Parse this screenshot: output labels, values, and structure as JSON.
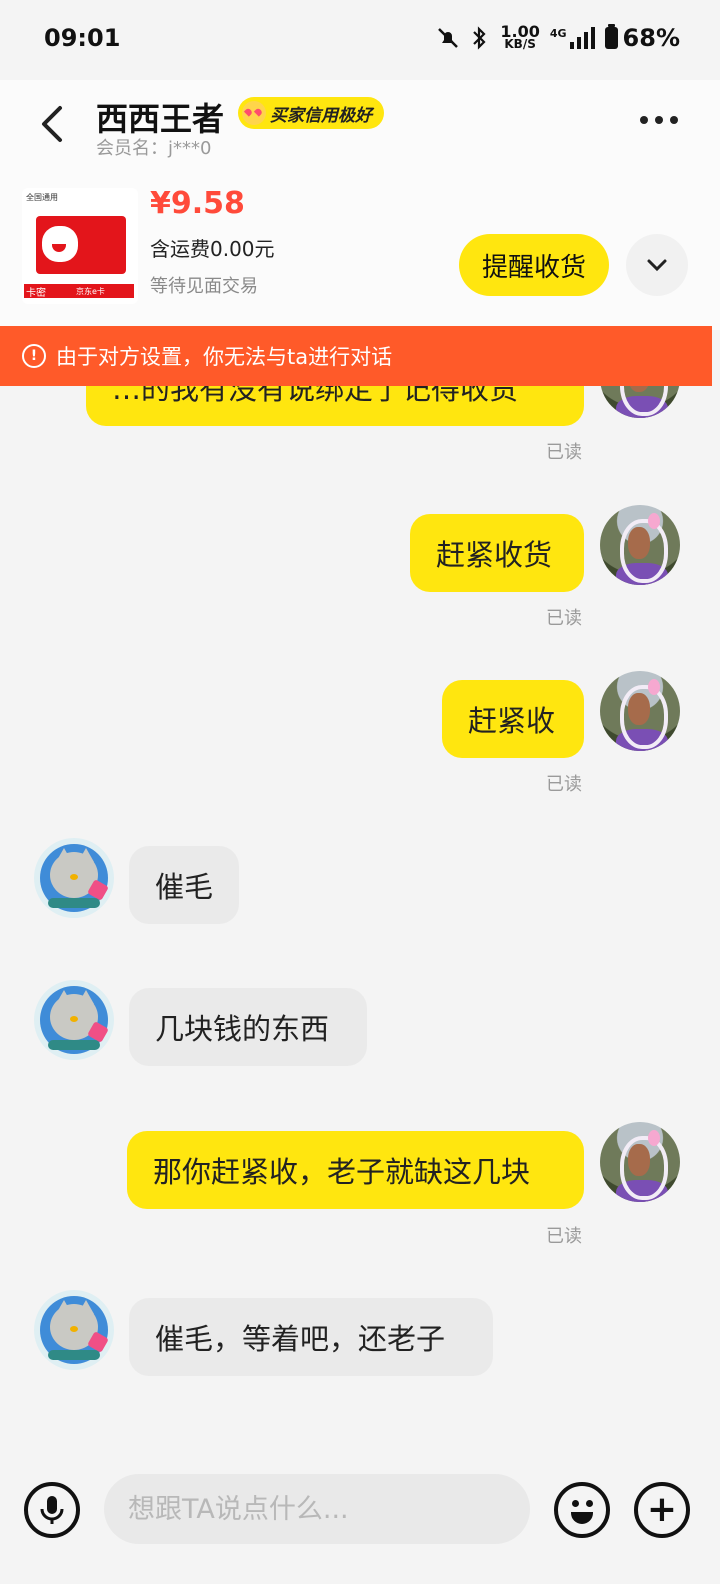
{
  "status_bar": {
    "time": "09:01",
    "net_speed": "1.00",
    "net_unit": "KB/S",
    "network": "4G",
    "battery": "68%",
    "icons": [
      "mute-bell-icon",
      "bluetooth-icon",
      "signal-icon",
      "battery-icon"
    ]
  },
  "header": {
    "title": "西西王者",
    "badge": "买家信用极好",
    "member_label": "会员名：j***0"
  },
  "product": {
    "thumb_tag": "全国通用",
    "thumb_label_left": "卡密",
    "thumb_label_right": "京东e卡",
    "price": "¥9.58",
    "shipping": "含运费0.00元",
    "status": "等待见面交易",
    "action_button": "提醒收货"
  },
  "banner": {
    "text": "由于对方设置，你无法与ta进行对话"
  },
  "messages": [
    {
      "side": "mine",
      "text": "…的我有没有说绑定了记得收货",
      "read": "已读"
    },
    {
      "side": "mine",
      "text": "赶紧收货",
      "read": "已读"
    },
    {
      "side": "mine",
      "text": "赶紧收",
      "read": "已读"
    },
    {
      "side": "theirs",
      "text": "催毛"
    },
    {
      "side": "theirs",
      "text": "几块钱的东西"
    },
    {
      "side": "mine",
      "text": "那你赶紧收，老子就缺这几块",
      "read": "已读"
    },
    {
      "side": "theirs",
      "text": "催毛，等着吧，还老子"
    }
  ],
  "input": {
    "placeholder": "想跟TA说点什么..."
  },
  "colors": {
    "accent_yellow": "#ffe60f",
    "price_red": "#ff4a3a",
    "banner_orange": "#ff5a29"
  }
}
